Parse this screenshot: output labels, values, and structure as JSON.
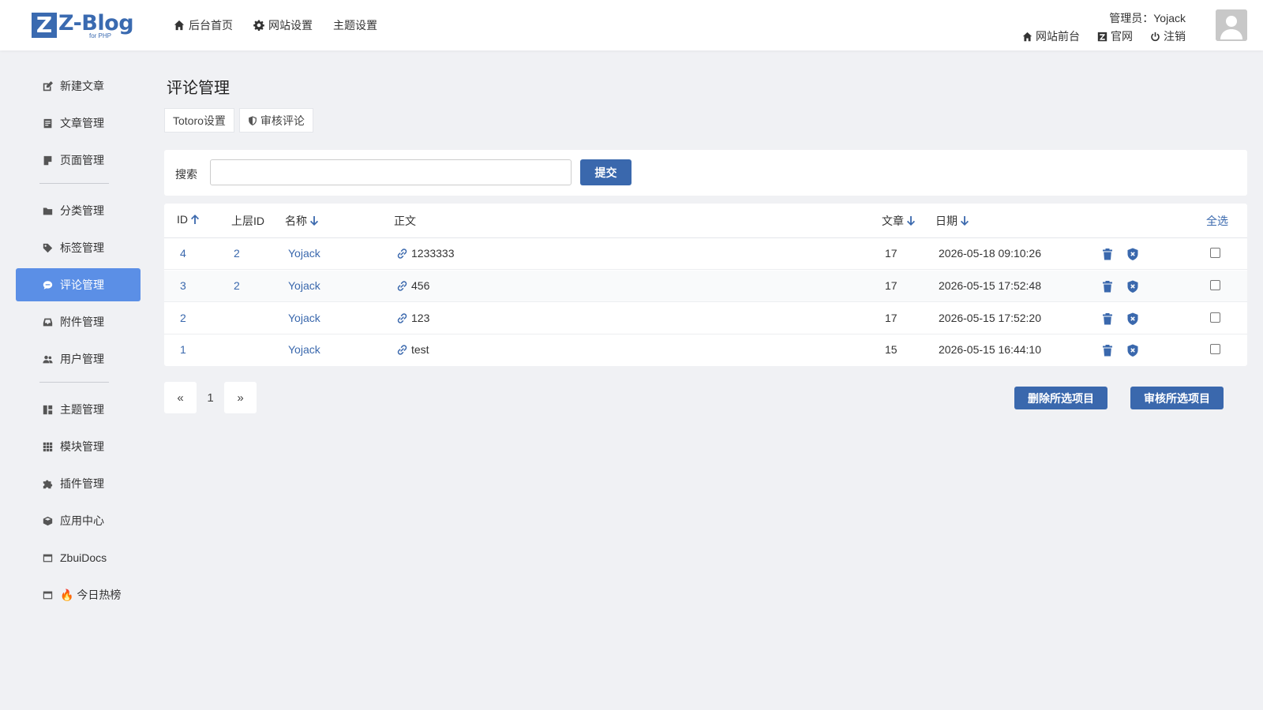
{
  "app": {
    "logo_letter": "Z",
    "logo_text": "Z-Blog",
    "logo_sub": "for PHP"
  },
  "topnav": [
    {
      "label": "后台首页",
      "icon": "home-icon"
    },
    {
      "label": "网站设置",
      "icon": "gear-icon"
    },
    {
      "label": "主题设置",
      "icon": ""
    }
  ],
  "user": {
    "admin_label": "管理员：Yojack",
    "links": [
      {
        "label": "网站前台",
        "icon": "home-icon"
      },
      {
        "label": "官网",
        "icon": "zblog-icon"
      },
      {
        "label": "注销",
        "icon": "power-icon"
      }
    ]
  },
  "sidebar": {
    "items": [
      {
        "label": "新建文章",
        "icon": "edit-icon"
      },
      {
        "label": "文章管理",
        "icon": "article-icon"
      },
      {
        "label": "页面管理",
        "icon": "page-icon"
      },
      {
        "label": "分类管理",
        "icon": "folder-icon"
      },
      {
        "label": "标签管理",
        "icon": "tag-icon"
      },
      {
        "label": "评论管理",
        "icon": "comment-icon",
        "active": true
      },
      {
        "label": "附件管理",
        "icon": "inbox-icon"
      },
      {
        "label": "用户管理",
        "icon": "users-icon"
      },
      {
        "label": "主题管理",
        "icon": "layout-icon"
      },
      {
        "label": "模块管理",
        "icon": "grid-icon"
      },
      {
        "label": "插件管理",
        "icon": "puzzle-icon"
      },
      {
        "label": "应用中心",
        "icon": "box-icon"
      },
      {
        "label": "ZbuiDocs",
        "icon": "window-icon"
      },
      {
        "label": "🔥 今日热榜",
        "icon": "window-icon"
      }
    ]
  },
  "main": {
    "title": "评论管理",
    "tabs": [
      {
        "label": "Totoro设置"
      },
      {
        "label": "审核评论",
        "icon": "shield-icon"
      }
    ],
    "search": {
      "label": "搜索",
      "value": "",
      "placeholder": "",
      "submit_label": "提交"
    },
    "table": {
      "headers": {
        "id": "ID",
        "parent_id": "上层ID",
        "name": "名称",
        "body": "正文",
        "article": "文章",
        "date": "日期",
        "select_all": "全选"
      },
      "rows": [
        {
          "id": "4",
          "parent_id": "2",
          "name": "Yojack",
          "body": "1233333",
          "article": "17",
          "date": "2026-05-18 09:10:26"
        },
        {
          "id": "3",
          "parent_id": "2",
          "name": "Yojack",
          "body": "456",
          "article": "17",
          "date": "2026-05-15 17:52:48"
        },
        {
          "id": "2",
          "parent_id": "",
          "name": "Yojack",
          "body": "123",
          "article": "17",
          "date": "2026-05-15 17:52:20"
        },
        {
          "id": "1",
          "parent_id": "",
          "name": "Yojack",
          "body": "test",
          "article": "15",
          "date": "2026-05-15 16:44:10"
        }
      ]
    },
    "pager": {
      "prev": "«",
      "page": "1",
      "next": "»"
    },
    "bulk": {
      "delete_label": "删除所选项目",
      "approve_label": "审核所选项目"
    }
  },
  "colors": {
    "accent": "#3a68ad",
    "sidebar_active": "#5b8fe6",
    "background": "#f0f1f4"
  }
}
